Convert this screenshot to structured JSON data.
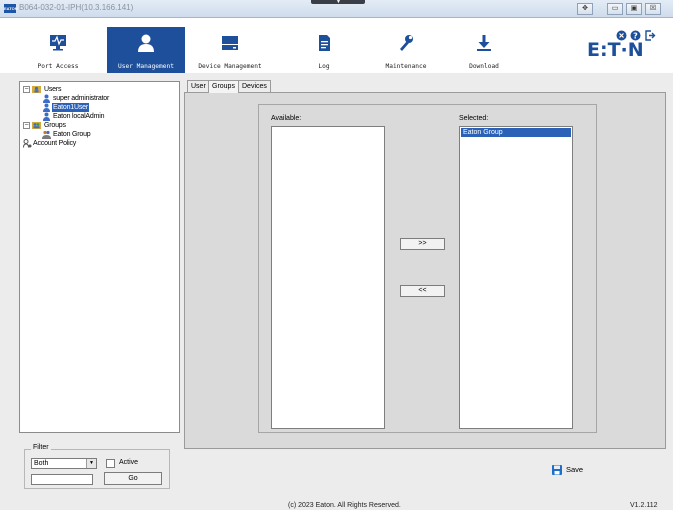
{
  "window": {
    "badge": "EATON",
    "title": "B064-032-01-IPH(10.3.166.141)",
    "buttons": [
      "✥",
      "▭",
      "▣",
      "☒"
    ]
  },
  "nav": {
    "items": [
      {
        "label": "Port Access",
        "icon": "port-access-icon",
        "active": false
      },
      {
        "label": "User Management",
        "icon": "user-icon",
        "active": true
      },
      {
        "label": "Device Management",
        "icon": "device-icon",
        "active": false
      },
      {
        "label": "Log",
        "icon": "log-icon",
        "active": false
      },
      {
        "label": "Maintenance",
        "icon": "wrench-icon",
        "active": false
      },
      {
        "label": "Download",
        "icon": "download-icon",
        "active": false
      }
    ],
    "header_icons": [
      "settings-icon",
      "help-icon",
      "logout-icon"
    ],
    "logo": "E:T·N"
  },
  "tree": {
    "users_label": "Users",
    "users": [
      {
        "label": "super administrator",
        "selected": false
      },
      {
        "label": "Eaton1User",
        "selected": true
      },
      {
        "label": "Eaton localAdmin",
        "selected": false
      }
    ],
    "groups_label": "Groups",
    "groups": [
      {
        "label": "Eaton Group"
      }
    ],
    "account_policy_label": "Account Policy"
  },
  "filter": {
    "legend": "Filter",
    "select_value": "Both",
    "active_label": "Active",
    "text_value": "",
    "go_label": "Go"
  },
  "tabs": [
    {
      "label": "User",
      "active": false
    },
    {
      "label": "Groups",
      "active": true
    },
    {
      "label": "Devices",
      "active": false
    }
  ],
  "groups_panel": {
    "available_label": "Available:",
    "selected_label": "Selected:",
    "available_items": [],
    "selected_items": [
      "Eaton Group"
    ],
    "add_label": ">>",
    "remove_label": "<<"
  },
  "save_label": "Save",
  "footer": "(c) 2023 Eaton. All Rights Reserved.",
  "version": "V1.2.112",
  "colors": {
    "accent": "#1d4f9b",
    "selection": "#2b62b7"
  }
}
